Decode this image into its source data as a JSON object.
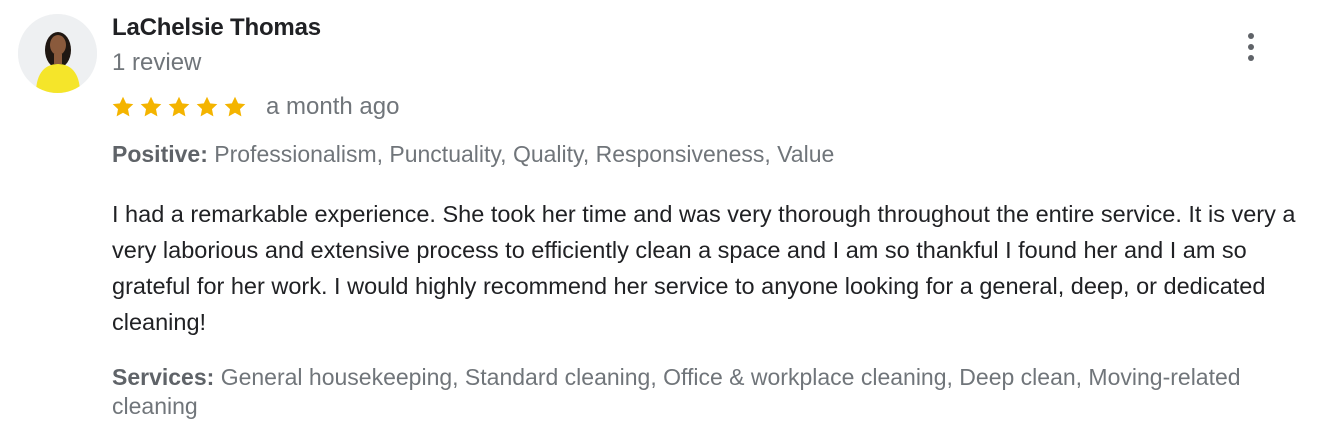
{
  "reviewer": {
    "name": "LaChelsie Thomas",
    "review_count": "1 review",
    "avatar_icon": "person-avatar-icon"
  },
  "rating": {
    "stars": 5,
    "max": 5,
    "star_color": "#f4b400",
    "time": "a month ago"
  },
  "positive": {
    "label": "Positive:",
    "value": "Professionalism, Punctuality, Quality, Responsiveness, Value"
  },
  "review_text": "I had a remarkable experience. She took her time and was very thorough throughout the entire service. It is very a very laborious and extensive process to efficiently clean a space and I am so thankful I found her and I am so grateful for her work. I would highly recommend her service to anyone looking for a general, deep, or dedicated cleaning!",
  "services": {
    "label": "Services:",
    "value": "General housekeeping, Standard cleaning, Office & workplace cleaning, Deep clean, Moving-related cleaning"
  },
  "menu_icon": "more-vert-icon"
}
